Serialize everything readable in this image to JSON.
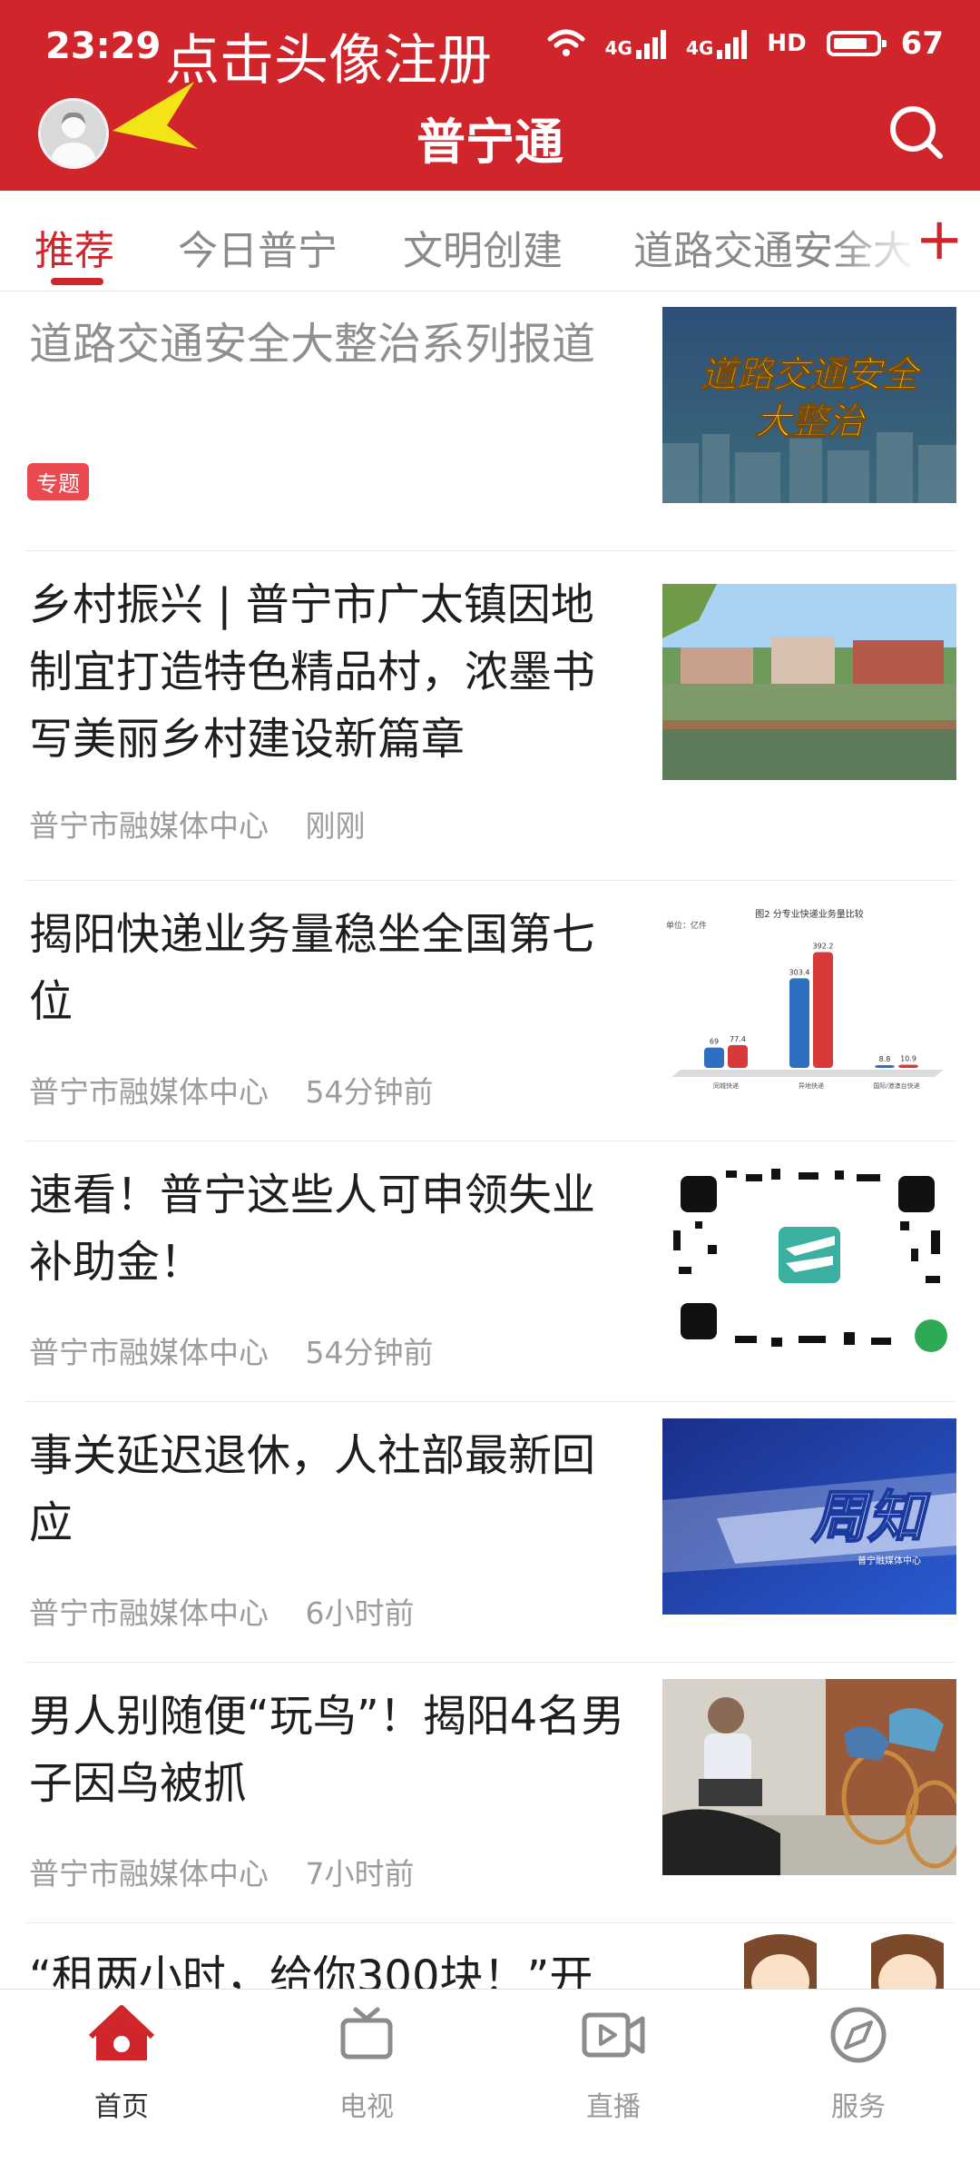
{
  "status_bar": {
    "time": "23:29",
    "network_1": "4G",
    "network_2": "4G",
    "hd": "HD",
    "battery": "67"
  },
  "annotation": "点击头像注册",
  "header": {
    "title": "普宁通"
  },
  "tabs": [
    "推荐",
    "今日普宁",
    "文明创建",
    "道路交通安全大"
  ],
  "tab_add": "+",
  "feed": [
    {
      "title": "道路交通安全大整治系列报道",
      "tag": "专题",
      "thumb_text": "道路交通安全\n大整治"
    },
    {
      "title": "乡村振兴 | 普宁市广太镇因地制宜打造特色精品村，浓墨书写美丽乡村建设新篇章",
      "source": "普宁市融媒体中心",
      "time": "刚刚"
    },
    {
      "title": "揭阳快递业务量稳坐全国第七位",
      "source": "普宁市融媒体中心",
      "time": "54分钟前"
    },
    {
      "title": "速看！普宁这些人可申领失业补助金！",
      "source": "普宁市融媒体中心",
      "time": "54分钟前"
    },
    {
      "title": "事关延迟退休，人社部最新回应",
      "source": "普宁市融媒体中心",
      "time": "6小时前",
      "thumb_text": "周知",
      "thumb_sub": "普宁融媒体中心"
    },
    {
      "title": "男人别随便“玩鸟”！揭阳4名男子因鸟被抓",
      "source": "普宁市融媒体中心",
      "time": "7小时前"
    },
    {
      "title": "“租两小时，给你300块！”开"
    }
  ],
  "chart_thumb": {
    "title": "图2  分专业快递业务量比较",
    "unit_label": "单位：亿件",
    "categories": [
      "同城快递",
      "异地快递",
      "国际/港澳台快递"
    ],
    "series": [
      {
        "values": [
          69,
          303.4,
          8.8
        ],
        "color": "#2f6fc2"
      },
      {
        "values": [
          77.4,
          392.2,
          10.9
        ],
        "color": "#d83a3a"
      }
    ],
    "value_labels": [
      "69",
      "77.4",
      "303.4",
      "392.2",
      "8.8",
      "10.9"
    ]
  },
  "bottom_nav": [
    {
      "label": "首页",
      "icon": "home-icon",
      "active": true
    },
    {
      "label": "电视",
      "icon": "tv-icon",
      "active": false
    },
    {
      "label": "直播",
      "icon": "live-video-icon",
      "active": false
    },
    {
      "label": "服务",
      "icon": "compass-icon",
      "active": false
    }
  ],
  "colors": {
    "brand_red": "#d0262b",
    "tag_red": "#e84a4f",
    "annotation_arrow": "#f3e418"
  }
}
